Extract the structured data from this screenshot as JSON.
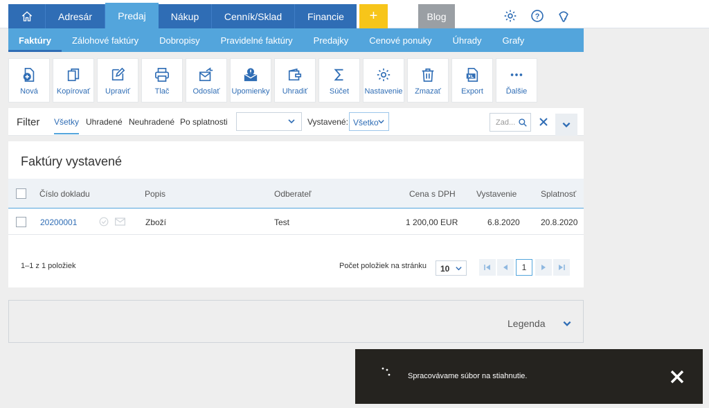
{
  "nav": {
    "home_icon": "home-icon",
    "items": [
      "Adresár",
      "Predaj",
      "Nákup",
      "Cenník/Sklad",
      "Financie"
    ],
    "plus": "+",
    "blog": "Blog",
    "icons": [
      "gear-icon",
      "help-icon",
      "bug-icon"
    ],
    "colors": {
      "primary": "#2f6db5",
      "active": "#53a5dc",
      "plus": "#f7c51a",
      "blog": "#9a9fa4"
    }
  },
  "subnav": [
    "Faktúry",
    "Zálohové faktúry",
    "Dobropisy",
    "Pravidelné faktúry",
    "Predajky",
    "Cenové ponuky",
    "Úhrady",
    "Grafy"
  ],
  "toolbar": [
    {
      "label": "Nová",
      "icon": "new-doc-icon"
    },
    {
      "label": "Kopírovať",
      "icon": "copy-icon"
    },
    {
      "label": "Upraviť",
      "icon": "edit-icon"
    },
    {
      "label": "Tlač",
      "icon": "print-icon"
    },
    {
      "label": "Odoslať",
      "icon": "send-icon"
    },
    {
      "label": "Upomienky",
      "icon": "reminder-icon"
    },
    {
      "label": "Uhradiť",
      "icon": "wallet-icon"
    },
    {
      "label": "Súčet",
      "icon": "sum-icon"
    },
    {
      "label": "Nastavenie",
      "icon": "gear-icon"
    },
    {
      "label": "Zmazať",
      "icon": "trash-icon"
    },
    {
      "label": "Export",
      "icon": "export-icon"
    },
    {
      "label": "Ďalšie",
      "icon": "more-icon"
    }
  ],
  "filter": {
    "title": "Filter",
    "tabs": [
      "Všetky",
      "Uhradené",
      "Neuhradené",
      "Po splatnosti"
    ],
    "select_value": "",
    "vystavene_label": "Vystavené:",
    "vystavene_value": "Všetko",
    "search_placeholder": "Zad..."
  },
  "panel": {
    "title": "Faktúry vystavené",
    "columns": [
      "Číslo dokladu",
      "Popis",
      "Odberateľ",
      "Cena s DPH",
      "Vystavenie",
      "Splatnosť"
    ],
    "rows": [
      {
        "cislo": "20200001",
        "popis": "Zboží",
        "odberatel": "Test",
        "cena": "1 200,00 EUR",
        "vystavenie": "6.8.2020",
        "splatnost": "20.8.2020"
      }
    ],
    "count_text": "1–1 z 1 položiek",
    "per_page_label": "Počet položiek na stránku",
    "per_page": "10",
    "current_page": "1"
  },
  "legend": {
    "label": "Legenda"
  },
  "toast": {
    "message": "Spracovávame súbor na stiahnutie."
  }
}
